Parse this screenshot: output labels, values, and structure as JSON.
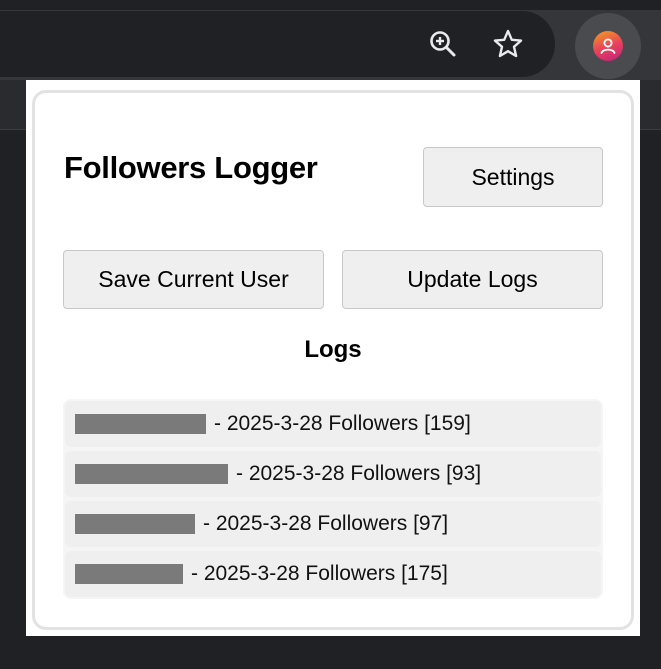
{
  "browser": {
    "icons": [
      "zoom-icon",
      "star-icon",
      "profile-icon"
    ]
  },
  "popup": {
    "title": "Followers Logger",
    "settings_label": "Settings",
    "save_label": "Save Current User",
    "update_label": "Update Logs",
    "logs_heading": "Logs",
    "logs": [
      {
        "text": "- 2025-3-28 Followers [159]"
      },
      {
        "text": "- 2025-3-28 Followers [93]"
      },
      {
        "text": "- 2025-3-28 Followers [97]"
      },
      {
        "text": "- 2025-3-28 Followers [175]"
      }
    ]
  },
  "colors": {
    "toolbar": "#35363a",
    "popup_bg": "#ffffff",
    "button_bg": "#efefef",
    "redaction": "#7a7a7a"
  }
}
